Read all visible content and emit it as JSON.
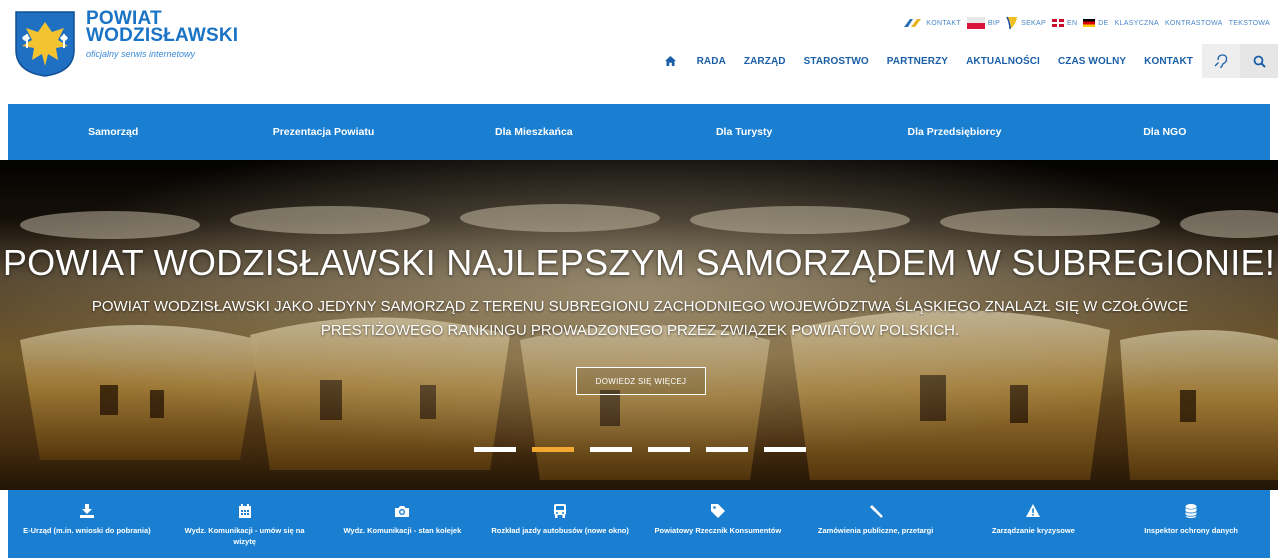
{
  "brand": {
    "line1": "POWIAT",
    "line2": "WODZISŁAWSKI",
    "subtitle": "oficjalny serwis internetowy"
  },
  "toplinks": {
    "kontakt": "KONTAKT",
    "bip": "BIP",
    "sekap": "SEKAP",
    "en": "EN",
    "de": "DE",
    "klasyczna": "KLASYCZNA",
    "kontrastowa": "KONTRASTOWA",
    "tekstowa": "TEKSTOWA"
  },
  "mainnav": {
    "items": [
      "RADA",
      "ZARZĄD",
      "STAROSTWO",
      "PARTNERZY",
      "AKTUALNOŚCI",
      "CZAS WOLNY",
      "KONTAKT"
    ]
  },
  "bluemenu": {
    "items": [
      "Samorząd",
      "Prezentacja Powiatu",
      "Dla Mieszkańca",
      "Dla Turysty",
      "Dla Przedsiębiorcy",
      "Dla NGO"
    ]
  },
  "hero": {
    "title": "POWIAT WODZISŁAWSKI NAJLEPSZYM SAMORZĄDEM W SUBREGIONIE!",
    "subtitle": "POWIAT WODZISŁAWSKI JAKO JEDYNY SAMORZĄD Z TERENU SUBREGIONU ZACHODNIEGO WOJEWÓDZTWA ŚLĄSKIEGO ZNALAZŁ SIĘ W CZOŁÓWCE PRESTIŻOWEGO RANKINGU PROWADZONEGO PRZEZ ZWIĄZEK POWIATÓW POLSKICH.",
    "button": "DOWIEDZ SIĘ WIĘCEJ",
    "slides_total": 6,
    "slide_active": 2
  },
  "quicklinks": {
    "items": [
      {
        "label": "E-Urząd (m.in. wnioski do pobrania)",
        "icon": "download-icon"
      },
      {
        "label": "Wydz. Komunikacji - umów się na wizytę",
        "icon": "calendar-icon"
      },
      {
        "label": "Wydz. Komunikacji - stan kolejek",
        "icon": "camera-icon"
      },
      {
        "label": "Rozkład jazdy autobusów (nowe okno)",
        "icon": "bus-icon"
      },
      {
        "label": "Powiatowy Rzecznik Konsumentów",
        "icon": "tag-icon"
      },
      {
        "label": "Zamówienia publiczne, przetargi",
        "icon": "gavel-icon"
      },
      {
        "label": "Zarządzanie kryzysowe",
        "icon": "warning-icon"
      },
      {
        "label": "Inspektor ochrony danych",
        "icon": "database-icon"
      }
    ]
  },
  "colors": {
    "brand_blue": "#1a7fd0",
    "nav_text": "#1a5fa8",
    "slider_active": "#f0a830"
  }
}
